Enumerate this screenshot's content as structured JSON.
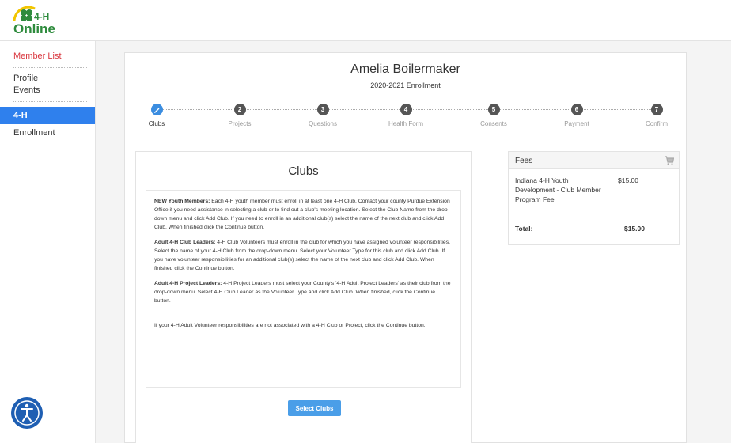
{
  "logo": {
    "top": "4-H",
    "bottom": "Online"
  },
  "sidebar": {
    "member_list": "Member List",
    "profile": "Profile",
    "events": "Events",
    "section": "4-H",
    "enrollment": "Enrollment"
  },
  "header": {
    "name": "Amelia Boilermaker",
    "year": "2020-2021 Enrollment"
  },
  "steps": [
    {
      "num": "",
      "label": "Clubs"
    },
    {
      "num": "2",
      "label": "Projects"
    },
    {
      "num": "3",
      "label": "Questions"
    },
    {
      "num": "4",
      "label": "Health Form"
    },
    {
      "num": "5",
      "label": "Consents"
    },
    {
      "num": "6",
      "label": "Payment"
    },
    {
      "num": "7",
      "label": "Confirm"
    }
  ],
  "clubs": {
    "title": "Clubs",
    "p1_bold": "NEW Youth Members:",
    "p1": " Each 4-H youth member must enroll in at least one 4-H Club.  Contact your county Purdue Extension Office if you need assistance in selecting a club or to find out a club's meeting location.  Select the Club Name from the drop-down menu and click Add Club.  If you need to enroll in an additional club(s) select the name of the next club and click Add Club. When finished click the Continue button.",
    "p2_bold": "Adult 4-H Club Leaders:",
    "p2": " 4-H Club Volunteers must enroll in the club for which you have assigned volunteer responsibilities. Select the name of your 4-H Club from the drop-down menu.  Select your Volunteer Type for this club and click Add Club.  If you have volunteer responsibilities for an additional club(s) select the name of the next club and click Add Club. When finished click the Continue button.",
    "p3_bold": "Adult 4-H Project Leaders:",
    "p3": " 4-H Project Leaders must select your County's '4-H Adult Project Leaders' as their club from the drop-down menu.  Select 4-H Club Leader as the Volunteer Type and click Add Club.  When finished, click the Continue button.",
    "p4": "If your 4-H Adult Volunteer responsibilities are not associated with a 4-H Club or Project, click the Continue button.",
    "button": "Select Clubs"
  },
  "fees": {
    "title": "Fees",
    "item_desc": "Indiana 4-H Youth Development - Club Member Program Fee",
    "item_amount": "$15.00",
    "total_label": "Total:",
    "total_amount": "$15.00"
  },
  "colors": {
    "accent": "#2f80ed",
    "button": "#4a9ee8",
    "member_list": "#d9363e"
  },
  "icons": [
    "clover-logo-icon",
    "pencil-icon",
    "cart-icon",
    "accessibility-icon"
  ]
}
